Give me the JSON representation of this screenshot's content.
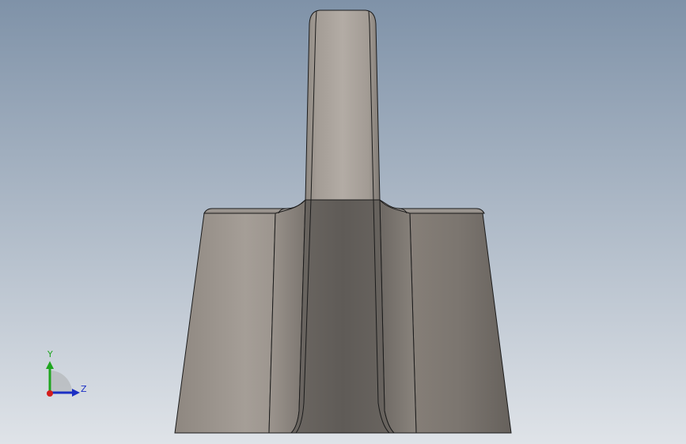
{
  "viewport": {
    "background_top": "#7f92a8",
    "background_bottom": "#dfe3e8"
  },
  "triad": {
    "y_label": "Y",
    "z_label": "Z",
    "y_color": "#1fa51f",
    "z_color": "#1b2fc4",
    "x_color": "#d41d1d",
    "y_label_color": "#1fa51f",
    "z_label_color": "#1b2fc4"
  },
  "model": {
    "edge_color": "#1b1b1b",
    "base_light": "#a49c95",
    "base_dark": "#6f6a63",
    "center_face": "#5f5b57",
    "fin_top": "#aba49d"
  }
}
